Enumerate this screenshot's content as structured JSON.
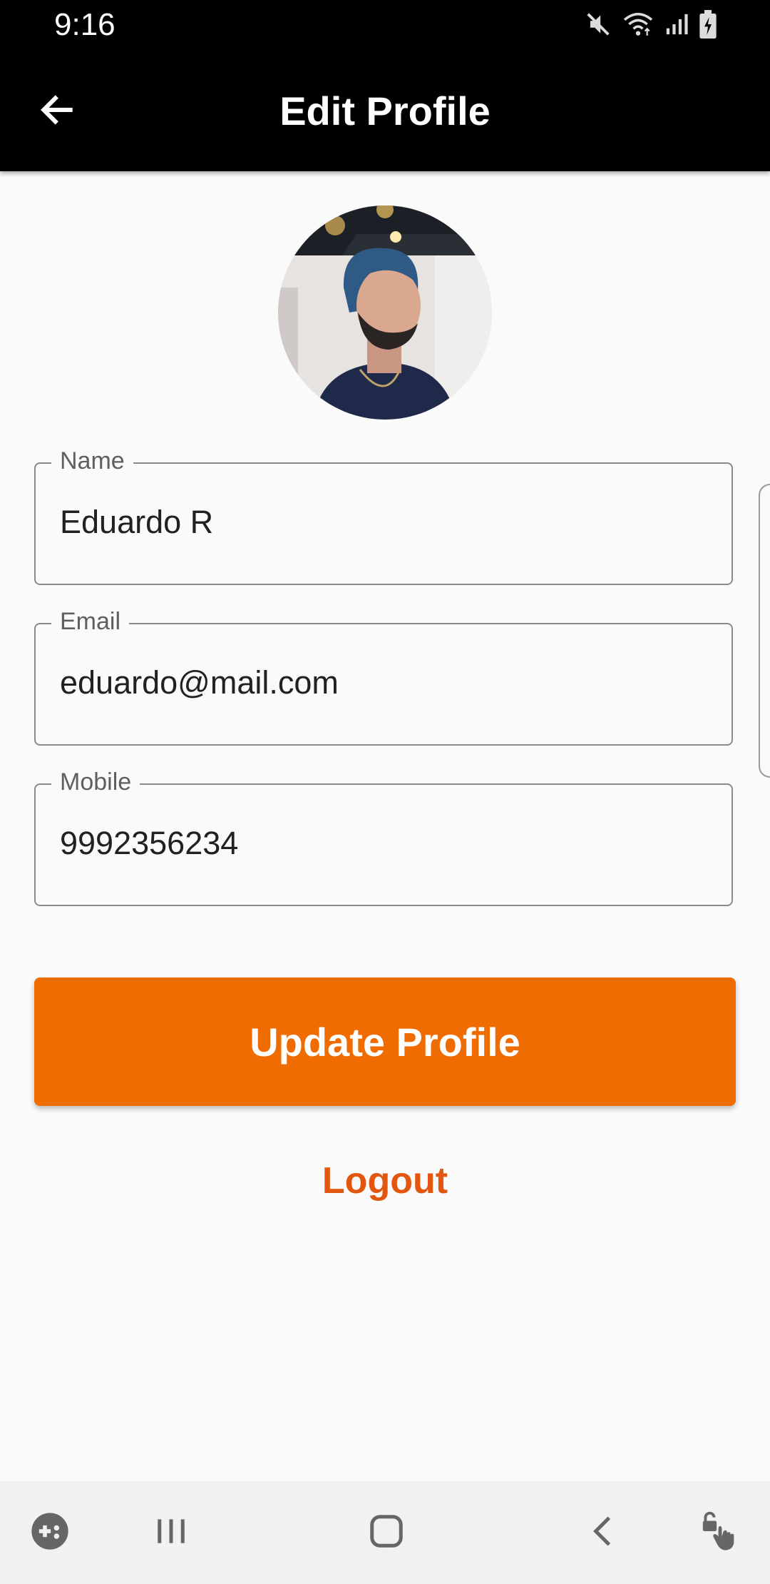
{
  "status_bar": {
    "time": "9:16",
    "icons": [
      "mute-icon",
      "wifi-icon",
      "signal-icon",
      "battery-charging-icon"
    ]
  },
  "app_bar": {
    "title": "Edit Profile",
    "back_icon": "arrow-back-icon"
  },
  "profile": {
    "avatar_icon": "profile-photo"
  },
  "form": {
    "name": {
      "label": "Name",
      "value": "Eduardo R"
    },
    "email": {
      "label": "Email",
      "value": "eduardo@mail.com"
    },
    "mobile": {
      "label": "Mobile",
      "value": "9992356234"
    }
  },
  "actions": {
    "update_label": "Update Profile",
    "logout_label": "Logout"
  },
  "colors": {
    "primary_orange": "#ee6c02",
    "logout_orange": "#e2560f",
    "app_bar": "#000000",
    "background": "#fafafa"
  },
  "nav_bar": {
    "icons": [
      "game-launcher-icon",
      "recent-apps-icon",
      "home-icon",
      "back-icon",
      "touch-lock-icon"
    ]
  }
}
